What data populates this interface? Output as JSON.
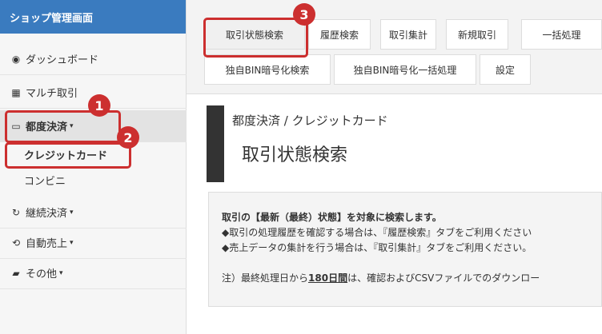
{
  "sidebar": {
    "header": "ショップ管理画面",
    "items": [
      {
        "icon": "dashboard-icon",
        "glyph": "◉",
        "label": "ダッシュボード"
      },
      {
        "icon": "grid-icon",
        "glyph": "▦",
        "label": "マルチ取引"
      },
      {
        "icon": "card-icon",
        "glyph": "▭",
        "label": "都度決済"
      },
      {
        "icon": "refresh-icon",
        "glyph": "↻",
        "label": "継続決済"
      },
      {
        "icon": "cycle-icon",
        "glyph": "⟲",
        "label": "自動売上"
      },
      {
        "icon": "folder-icon",
        "glyph": "▰",
        "label": "その他"
      }
    ],
    "subitems": [
      "クレジットカード",
      "コンビニ"
    ]
  },
  "tabs": {
    "row1": [
      "取引状態検索",
      "履歴検索",
      "取引集計",
      "新規取引",
      "一括処理"
    ],
    "row2": [
      "独自BIN暗号化検索",
      "独自BIN暗号化一括処理",
      "設定"
    ]
  },
  "main": {
    "breadcrumb": "都度決済 / クレジットカード",
    "title": "取引状態検索"
  },
  "info": {
    "line1": "取引の【最新（最終）状態】を対象に検索します。",
    "line2": "◆取引の処理履歴を確認する場合は、『履歴検索』タブをご利用ください",
    "line3": "◆売上データの集計を行う場合は、『取引集計』タブをご利用ください。",
    "line4_pre": "注）最終処理日から",
    "line4_em": "180日間",
    "line4_post": "は、確認およびCSVファイルでのダウンロー"
  },
  "annotations": [
    "1",
    "2",
    "3"
  ],
  "colors": {
    "accent": "#cc2f2f",
    "sidebar_header": "#3a7bbf"
  }
}
